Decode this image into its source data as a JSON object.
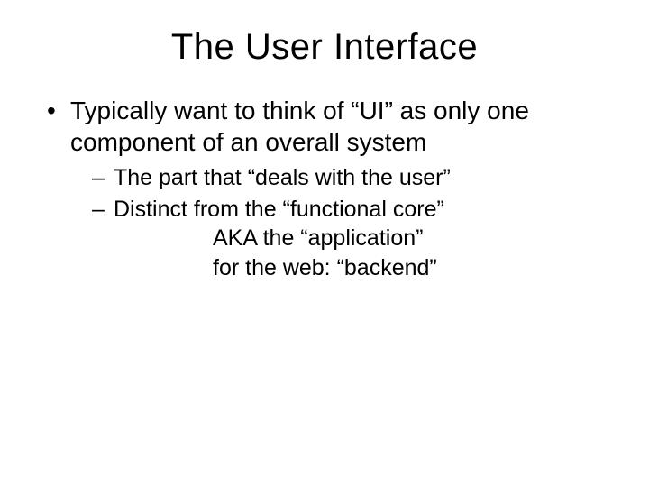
{
  "title": "The User Interface",
  "bullets": [
    {
      "text": "Typically want to think of “UI” as only one component of an overall system",
      "sub": [
        {
          "text": "The part that “deals with the user”"
        },
        {
          "text": "Distinct from the “functional core”",
          "indent_lines": [
            "AKA the “application”",
            "for the web: “backend”"
          ]
        }
      ]
    }
  ]
}
